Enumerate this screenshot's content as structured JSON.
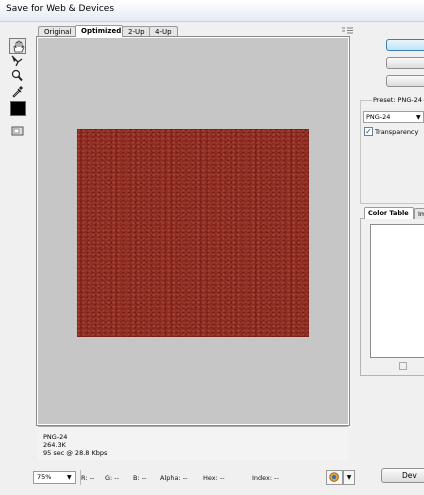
{
  "window": {
    "title": "Save for Web & Devices"
  },
  "tabs": [
    {
      "label": "Original"
    },
    {
      "label": "Optimized",
      "active": true
    },
    {
      "label": "2-Up"
    },
    {
      "label": "4-Up"
    }
  ],
  "tools": {
    "hand": "hand-icon",
    "slice_select": "slice-select-icon",
    "zoom": "zoom-icon",
    "eyedropper": "eyedropper-icon",
    "eyedropper_color": "#000000",
    "toggle_slices": "toggle-slices-icon"
  },
  "preview": {
    "image_icon": "leather-texture",
    "canvas_color": "#c6c6c6",
    "image_color": "#8c2a1f"
  },
  "info": {
    "format": "PNG-24",
    "size": "264.3K",
    "time": "95 sec @ 28.8 Kbps"
  },
  "statusbar": {
    "zoom": "75%",
    "r": "R:  --",
    "g": "G:  --",
    "b": "B:  --",
    "alpha": "Alpha:  --",
    "hex": "Hex:  --",
    "index": "Index:  --"
  },
  "right_panel": {
    "preset_label": "Preset:",
    "preset_value": "PNG-24",
    "format_value": "PNG-24",
    "transparency_label": "Transparency",
    "transparency_checked": "✓",
    "color_table_tab": "Color Table",
    "image_size_tab": "Im",
    "device_button": "Dev"
  }
}
